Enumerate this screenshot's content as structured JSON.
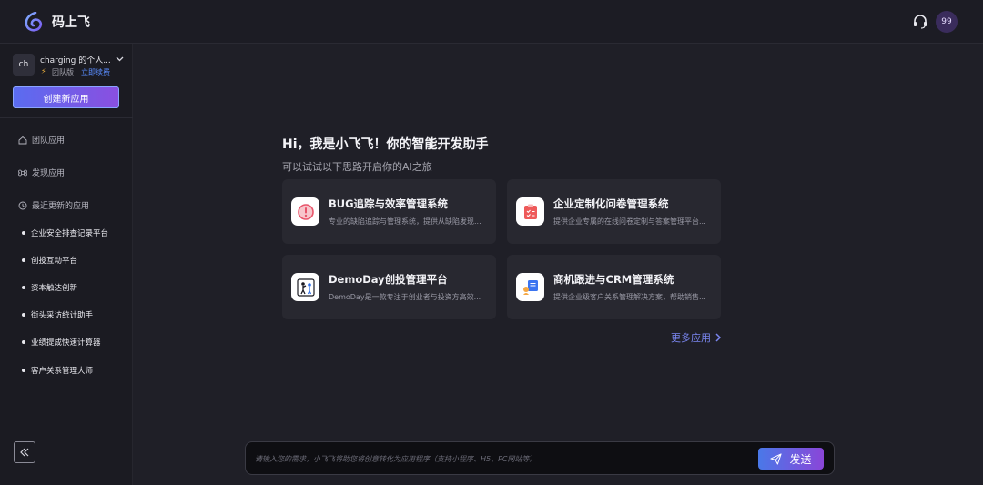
{
  "app": {
    "title": "码上飞"
  },
  "header": {
    "avatar_text": "99"
  },
  "workspace": {
    "avatar_text": "ch",
    "name": "charging 的个人...",
    "plan": "团队版",
    "renew": "立即续费",
    "create_label": "创建新应用"
  },
  "nav": {
    "team_apps": "团队应用",
    "discover_apps": "发现应用",
    "recent_apps": "最近更新的应用"
  },
  "recent": [
    "企业安全排查记录平台",
    "创投互动平台",
    "资本触达创新",
    "街头采访统计助手",
    "业绩提成快速计算器",
    "客户关系管理大师"
  ],
  "main": {
    "greeting": "Hi，我是小飞飞！你的智能开发助手",
    "subgreeting": "可以试试以下思路开启你的AI之旅",
    "cards": [
      {
        "title": "BUG追踪与效率管理系统",
        "desc": "专业的缺陷追踪与管理系统，提供从缺陷发现...",
        "icon": "bug-alert-icon",
        "color": "#e8546a"
      },
      {
        "title": "企业定制化问卷管理系统",
        "desc": "提供企业专属的在线问卷定制与答案管理平台...",
        "icon": "clipboard-checklist-icon",
        "color": "#ee5a5a"
      },
      {
        "title": "DemoDay创投管理平台",
        "desc": "DemoDay是一款专注于创业者与投资方高效...",
        "icon": "people-presentation-icon",
        "color": "#2f6fe8"
      },
      {
        "title": "商机跟进与CRM管理系统",
        "desc": "提供企业级客户关系管理解决方案，帮助销售...",
        "icon": "crm-board-icon",
        "color": "#3b74f0"
      }
    ],
    "more_label": "更多应用"
  },
  "composer": {
    "placeholder": "请输入您的需求，小飞飞将助您将创意转化为应用程序（支持小程序、H5、PC网站等）",
    "value": "",
    "send_label": "发送"
  }
}
